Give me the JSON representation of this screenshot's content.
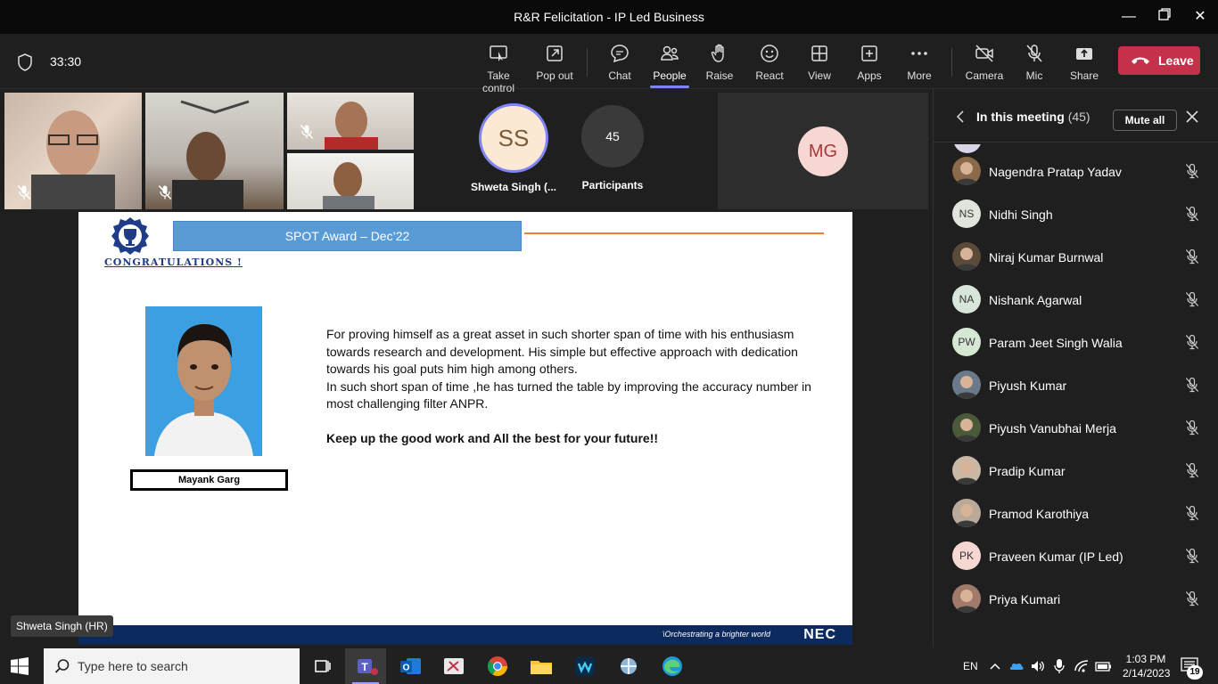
{
  "window": {
    "title": "R&R Felicitation - IP Led Business"
  },
  "toolbar": {
    "timer": "33:30",
    "buttons": [
      {
        "id": "take-control",
        "label": "Take control"
      },
      {
        "id": "pop-out",
        "label": "Pop out"
      },
      {
        "id": "chat",
        "label": "Chat"
      },
      {
        "id": "people",
        "label": "People"
      },
      {
        "id": "raise",
        "label": "Raise"
      },
      {
        "id": "react",
        "label": "React"
      },
      {
        "id": "view",
        "label": "View"
      },
      {
        "id": "apps",
        "label": "Apps"
      },
      {
        "id": "more",
        "label": "More"
      },
      {
        "id": "camera",
        "label": "Camera"
      },
      {
        "id": "mic",
        "label": "Mic"
      },
      {
        "id": "share",
        "label": "Share"
      }
    ],
    "active": "people",
    "leave_label": "Leave"
  },
  "video_strip": {
    "avatar_initials": "SS",
    "avatar_name": "Shweta Singh (...",
    "participants_count": "45",
    "participants_label": "Participants",
    "mg_initials": "MG"
  },
  "slide": {
    "banner": "SPOT Award – Dec’22",
    "congrats": "CONGRATULATIONS !",
    "name": "Mayank Garg",
    "paragraph_1": "For proving himself as a great asset in such shorter span of time with his enthusiasm towards research and development. His simple but effective approach with dedication towards his goal puts him high among others.",
    "paragraph_2": "In such short span of time ,he has turned the table by improving the accuracy number in most challenging filter ANPR.",
    "closing": "Keep up the good work and All the best for your future!!",
    "footer_tagline": "\\Orchestrating a brighter world",
    "footer_logo": "NEC"
  },
  "presenter_label": "Shweta Singh (HR)",
  "panel": {
    "title": "In this meeting",
    "count": "(45)",
    "mute_all": "Mute all",
    "participants": [
      {
        "name": "Nagendra Pratap Yadav",
        "initials": "",
        "avatar": "photo",
        "color": "#8a6a4a"
      },
      {
        "name": "Nidhi Singh",
        "initials": "NS",
        "avatar": "initials",
        "color": "#e0e4dc"
      },
      {
        "name": "Niraj Kumar Burnwal",
        "initials": "",
        "avatar": "photo",
        "color": "#5a4a3a"
      },
      {
        "name": "Nishank Agarwal",
        "initials": "NA",
        "avatar": "initials",
        "color": "#d8e6da"
      },
      {
        "name": "Param Jeet Singh Walia",
        "initials": "PW",
        "avatar": "initials",
        "color": "#d6e7d4"
      },
      {
        "name": "Piyush Kumar",
        "initials": "",
        "avatar": "photo",
        "color": "#6b7a8a"
      },
      {
        "name": "Piyush Vanubhai Merja",
        "initials": "",
        "avatar": "photo",
        "color": "#4a5a3a"
      },
      {
        "name": "Pradip Kumar",
        "initials": "",
        "avatar": "photo",
        "color": "#c9b8a6"
      },
      {
        "name": "Pramod Karothiya",
        "initials": "",
        "avatar": "photo",
        "color": "#b9a99a"
      },
      {
        "name": "Praveen Kumar (IP Led)",
        "initials": "PK",
        "avatar": "initials",
        "color": "#f6d7d3"
      },
      {
        "name": "Priya Kumari",
        "initials": "",
        "avatar": "photo",
        "color": "#a07a6a"
      }
    ]
  },
  "taskbar": {
    "search_placeholder": "Type here to search",
    "lang": "EN",
    "time": "1:03 PM",
    "date": "2/14/2023",
    "notifications": "19"
  }
}
